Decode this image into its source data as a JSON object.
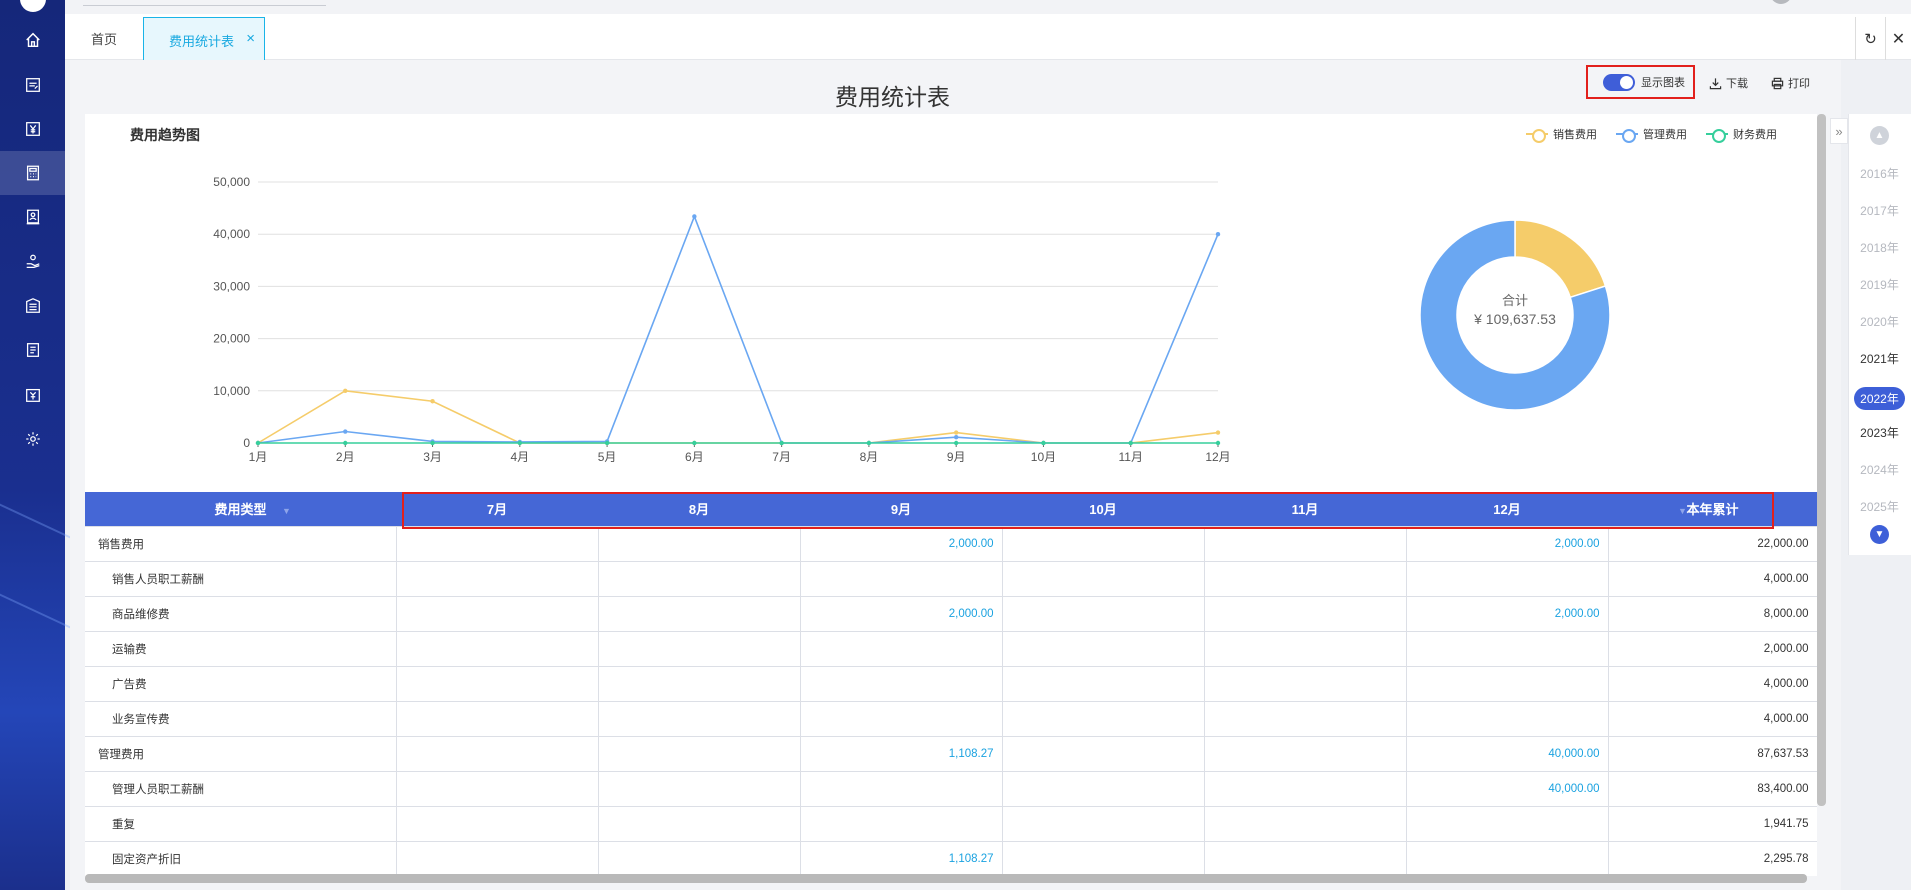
{
  "sidebar": {
    "icons": [
      "home-icon",
      "document-icon",
      "yen-icon",
      "calculator-icon",
      "person-card-icon",
      "coins-hand-icon",
      "building-icon",
      "clipboard-icon",
      "yen-card-icon",
      "gear-icon"
    ]
  },
  "tabs": {
    "home": "首页",
    "active": "费用统计表",
    "close": "×"
  },
  "header": {
    "title": "费用统计表",
    "toggle_label": "显示图表",
    "download_label": "下载",
    "print_label": "打印"
  },
  "chart": {
    "title": "费用趋势图"
  },
  "chart_data": [
    {
      "type": "line",
      "title": "费用趋势图",
      "categories": [
        "1月",
        "2月",
        "3月",
        "4月",
        "5月",
        "6月",
        "7月",
        "8月",
        "9月",
        "10月",
        "11月",
        "12月"
      ],
      "series": [
        {
          "name": "销售费用",
          "color": "#f5cc6a",
          "values": [
            0,
            10000,
            8000,
            0,
            0,
            0,
            0,
            0,
            2000,
            0,
            0,
            2000
          ]
        },
        {
          "name": "管理费用",
          "color": "#6aa7f2",
          "values": [
            0,
            2200,
            300,
            200,
            300,
            43400,
            0,
            0,
            1108.27,
            0,
            0,
            40000
          ]
        },
        {
          "name": "财务费用",
          "color": "#36cf9c",
          "values": [
            0,
            0,
            0,
            0,
            0,
            0,
            0,
            0,
            0,
            0,
            0,
            0
          ]
        }
      ],
      "yticks": [
        "0",
        "10,000",
        "20,000",
        "30,000",
        "40,000",
        "50,000"
      ],
      "ylim": [
        0,
        50000
      ],
      "grid": true,
      "legend": "top-right"
    },
    {
      "type": "pie",
      "center_label": "合计",
      "center_value": "¥ 109,637.53",
      "slices": [
        {
          "name": "销售费用",
          "color": "#f5cc6a",
          "value": 22000
        },
        {
          "name": "管理费用",
          "color": "#6aa7f2",
          "value": 87637.53
        },
        {
          "name": "财务费用",
          "color": "#36cf9c",
          "value": 0
        }
      ]
    }
  ],
  "table": {
    "columns": [
      "费用类型",
      "7月",
      "8月",
      "9月",
      "10月",
      "11月",
      "12月",
      "本年累计"
    ],
    "rows": [
      {
        "name": "销售费用",
        "sub": false,
        "cells": [
          "",
          "",
          "2,000.00",
          "",
          "",
          "2,000.00",
          "22,000.00"
        ]
      },
      {
        "name": "销售人员职工薪酬",
        "sub": true,
        "cells": [
          "",
          "",
          "",
          "",
          "",
          "",
          "4,000.00"
        ]
      },
      {
        "name": "商品维修费",
        "sub": true,
        "cells": [
          "",
          "",
          "2,000.00",
          "",
          "",
          "2,000.00",
          "8,000.00"
        ]
      },
      {
        "name": "运输费",
        "sub": true,
        "cells": [
          "",
          "",
          "",
          "",
          "",
          "",
          "2,000.00"
        ]
      },
      {
        "name": "广告费",
        "sub": true,
        "cells": [
          "",
          "",
          "",
          "",
          "",
          "",
          "4,000.00"
        ]
      },
      {
        "name": "业务宣传费",
        "sub": true,
        "cells": [
          "",
          "",
          "",
          "",
          "",
          "",
          "4,000.00"
        ]
      },
      {
        "name": "管理费用",
        "sub": false,
        "cells": [
          "",
          "",
          "1,108.27",
          "",
          "",
          "40,000.00",
          "87,637.53"
        ]
      },
      {
        "name": "管理人员职工薪酬",
        "sub": true,
        "cells": [
          "",
          "",
          "",
          "",
          "",
          "40,000.00",
          "83,400.00"
        ]
      },
      {
        "name": "重复",
        "sub": true,
        "cells": [
          "",
          "",
          "",
          "",
          "",
          "",
          "1,941.75"
        ]
      },
      {
        "name": "固定资产折旧",
        "sub": true,
        "cells": [
          "",
          "",
          "1,108.27",
          "",
          "",
          "",
          "2,295.78"
        ]
      }
    ]
  },
  "years": {
    "expand_icon": "»",
    "items": [
      {
        "label": "2016年",
        "state": "dim"
      },
      {
        "label": "2017年",
        "state": "dim"
      },
      {
        "label": "2018年",
        "state": "dim"
      },
      {
        "label": "2019年",
        "state": "dim"
      },
      {
        "label": "2020年",
        "state": "dim"
      },
      {
        "label": "2021年",
        "state": "norm"
      },
      {
        "label": "2022年",
        "state": "sel"
      },
      {
        "label": "2023年",
        "state": "norm"
      },
      {
        "label": "2024年",
        "state": "dim"
      },
      {
        "label": "2025年",
        "state": "dim"
      }
    ]
  }
}
